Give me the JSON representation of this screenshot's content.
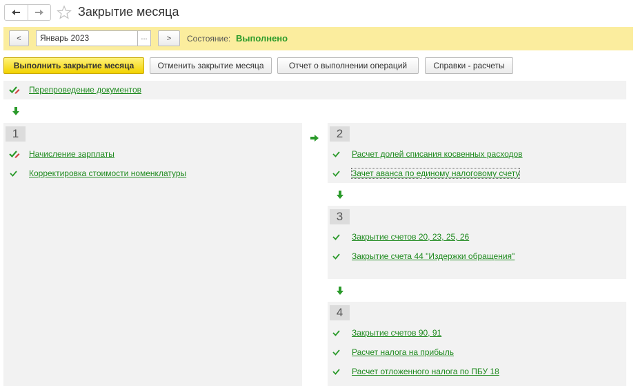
{
  "window": {
    "title": "Закрытие месяца",
    "nav_back_icon": "arrow-left-icon",
    "nav_forward_icon": "arrow-right-icon",
    "favorite_icon": "star-icon"
  },
  "period_bar": {
    "prev_label": "<",
    "period_value": "Январь 2023",
    "select_label": "...",
    "next_label": ">",
    "state_label": "Состояние:",
    "state_value": "Выполнено"
  },
  "toolbar": {
    "execute_label": "Выполнить закрытие месяца",
    "cancel_label": "Отменить закрытие месяца",
    "report_label": "Отчет о выполнении операций",
    "reference_label": "Справки - расчеты"
  },
  "reposting": {
    "label": "Перепроведение документов"
  },
  "stages": [
    {
      "number": "1",
      "operations": [
        {
          "label": "Начисление зарплаты",
          "status_icon": "check-with-pencil-icon"
        },
        {
          "label": "Корректировка стоимости номенклатуры",
          "status_icon": "check-icon"
        }
      ]
    },
    {
      "number": "2",
      "operations": [
        {
          "label": "Расчет долей списания косвенных расходов",
          "status_icon": "check-icon"
        },
        {
          "label": "Зачет аванса по единому налоговому счету",
          "status_icon": "check-icon"
        }
      ]
    },
    {
      "number": "3",
      "operations": [
        {
          "label": "Закрытие счетов 20, 23, 25, 26",
          "status_icon": "check-icon"
        },
        {
          "label": "Закрытие счета 44 \"Издержки обращения\"",
          "status_icon": "check-icon"
        }
      ]
    },
    {
      "number": "4",
      "operations": [
        {
          "label": "Закрытие счетов 90, 91",
          "status_icon": "check-icon"
        },
        {
          "label": "Расчет налога на прибыль",
          "status_icon": "check-icon"
        },
        {
          "label": "Расчет отложенного налога по ПБУ 18",
          "status_icon": "check-icon"
        }
      ]
    }
  ],
  "colors": {
    "state_ok": "#2a9a2a",
    "link": "#1e8a1e",
    "primary_button": "#f2d200",
    "period_bar_bg": "#fbed9e",
    "panel_bg": "#f2f2f2"
  }
}
